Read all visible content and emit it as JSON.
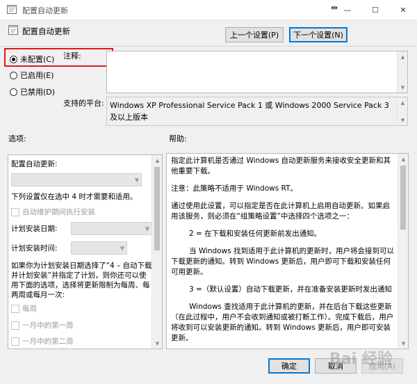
{
  "window": {
    "title": "配置自动更新",
    "minimize_glyph": "—",
    "maximize_glyph": "☐",
    "close_glyph": "✕"
  },
  "header": {
    "title": "配置自动更新",
    "prev_button": "上一个设置(P)",
    "next_button": "下一个设置(N)"
  },
  "radios": [
    {
      "label": "未配置(C)",
      "checked": true
    },
    {
      "label": "已启用(E)",
      "checked": false
    },
    {
      "label": "已禁用(D)",
      "checked": false
    }
  ],
  "comment_label": "注释:",
  "platform_label": "支持的平台:",
  "platform_text": "Windows XP Professional Service Pack 1 或 Windows 2000 Service Pack 3 及以上版本",
  "options_label": "选项:",
  "help_label": "帮助:",
  "options": {
    "configure_label": "配置自动更新:",
    "note": "下列设置仅在选中 4 时才需要和适用。",
    "maintenance_checkbox": "自动维护期间执行安装",
    "schedule_day_label": "计划安装日期:",
    "schedule_time_label": "计划安装时间:",
    "long_note": "如果你为计划安装日期选择了“4 – 自动下载并计划安装”并指定了计划，则你还可以使用下面的选项，选择将更新限制为每周、每两周或每月一次:",
    "weekly_checkbox": "每周",
    "first_week_checkbox": "一月中的第一周",
    "second_week_checkbox": "一月中的第二周"
  },
  "help_paragraphs": [
    "指定此计算机是否通过 Windows 自动更新服务来接收安全更新和其他重要下载。",
    "注意：此策略不适用于 Windows RT。",
    "通过使用此设置，可以指定是否在此计算机上启用自动更新。如果启用该服务，则必须在“组策略设置”中选择四个选项之一：",
    "2 = 在下载和安装任何更新前发出通知。",
    "当 Windows 找到适用于此计算机的更新时，用户将会接到可以下载更新的通知。转到 Windows 更新后，用户即可下载和安装任何可用更新。",
    "3 =（默认设置）自动下载更新，并在准备安装更新时发出通知",
    "Windows 查找适用于此计算机的更新，并在后台下载这些更新（在此过程中，用户不会收到通知或被打断工作）。完成下载后，用户将收到可以安装更新的通知。转到 Windows 更新后，用户即可安装更新。"
  ],
  "footer": {
    "ok": "确定",
    "cancel": "取消",
    "apply": "应用(A)"
  },
  "watermark": "Bai 经验"
}
